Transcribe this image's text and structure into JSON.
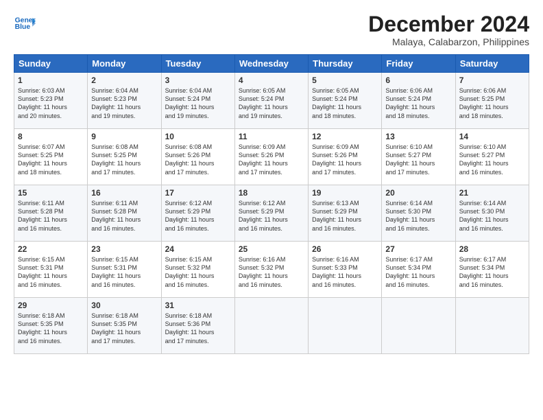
{
  "logo": {
    "line1": "General",
    "line2": "Blue"
  },
  "title": "December 2024",
  "location": "Malaya, Calabarzon, Philippines",
  "days_of_week": [
    "Sunday",
    "Monday",
    "Tuesday",
    "Wednesday",
    "Thursday",
    "Friday",
    "Saturday"
  ],
  "weeks": [
    [
      {
        "day": 1,
        "detail": "Sunrise: 6:03 AM\nSunset: 5:23 PM\nDaylight: 11 hours\nand 20 minutes."
      },
      {
        "day": 2,
        "detail": "Sunrise: 6:04 AM\nSunset: 5:23 PM\nDaylight: 11 hours\nand 19 minutes."
      },
      {
        "day": 3,
        "detail": "Sunrise: 6:04 AM\nSunset: 5:24 PM\nDaylight: 11 hours\nand 19 minutes."
      },
      {
        "day": 4,
        "detail": "Sunrise: 6:05 AM\nSunset: 5:24 PM\nDaylight: 11 hours\nand 19 minutes."
      },
      {
        "day": 5,
        "detail": "Sunrise: 6:05 AM\nSunset: 5:24 PM\nDaylight: 11 hours\nand 18 minutes."
      },
      {
        "day": 6,
        "detail": "Sunrise: 6:06 AM\nSunset: 5:24 PM\nDaylight: 11 hours\nand 18 minutes."
      },
      {
        "day": 7,
        "detail": "Sunrise: 6:06 AM\nSunset: 5:25 PM\nDaylight: 11 hours\nand 18 minutes."
      }
    ],
    [
      {
        "day": 8,
        "detail": "Sunrise: 6:07 AM\nSunset: 5:25 PM\nDaylight: 11 hours\nand 18 minutes."
      },
      {
        "day": 9,
        "detail": "Sunrise: 6:08 AM\nSunset: 5:25 PM\nDaylight: 11 hours\nand 17 minutes."
      },
      {
        "day": 10,
        "detail": "Sunrise: 6:08 AM\nSunset: 5:26 PM\nDaylight: 11 hours\nand 17 minutes."
      },
      {
        "day": 11,
        "detail": "Sunrise: 6:09 AM\nSunset: 5:26 PM\nDaylight: 11 hours\nand 17 minutes."
      },
      {
        "day": 12,
        "detail": "Sunrise: 6:09 AM\nSunset: 5:26 PM\nDaylight: 11 hours\nand 17 minutes."
      },
      {
        "day": 13,
        "detail": "Sunrise: 6:10 AM\nSunset: 5:27 PM\nDaylight: 11 hours\nand 17 minutes."
      },
      {
        "day": 14,
        "detail": "Sunrise: 6:10 AM\nSunset: 5:27 PM\nDaylight: 11 hours\nand 16 minutes."
      }
    ],
    [
      {
        "day": 15,
        "detail": "Sunrise: 6:11 AM\nSunset: 5:28 PM\nDaylight: 11 hours\nand 16 minutes."
      },
      {
        "day": 16,
        "detail": "Sunrise: 6:11 AM\nSunset: 5:28 PM\nDaylight: 11 hours\nand 16 minutes."
      },
      {
        "day": 17,
        "detail": "Sunrise: 6:12 AM\nSunset: 5:29 PM\nDaylight: 11 hours\nand 16 minutes."
      },
      {
        "day": 18,
        "detail": "Sunrise: 6:12 AM\nSunset: 5:29 PM\nDaylight: 11 hours\nand 16 minutes."
      },
      {
        "day": 19,
        "detail": "Sunrise: 6:13 AM\nSunset: 5:29 PM\nDaylight: 11 hours\nand 16 minutes."
      },
      {
        "day": 20,
        "detail": "Sunrise: 6:14 AM\nSunset: 5:30 PM\nDaylight: 11 hours\nand 16 minutes."
      },
      {
        "day": 21,
        "detail": "Sunrise: 6:14 AM\nSunset: 5:30 PM\nDaylight: 11 hours\nand 16 minutes."
      }
    ],
    [
      {
        "day": 22,
        "detail": "Sunrise: 6:15 AM\nSunset: 5:31 PM\nDaylight: 11 hours\nand 16 minutes."
      },
      {
        "day": 23,
        "detail": "Sunrise: 6:15 AM\nSunset: 5:31 PM\nDaylight: 11 hours\nand 16 minutes."
      },
      {
        "day": 24,
        "detail": "Sunrise: 6:15 AM\nSunset: 5:32 PM\nDaylight: 11 hours\nand 16 minutes."
      },
      {
        "day": 25,
        "detail": "Sunrise: 6:16 AM\nSunset: 5:32 PM\nDaylight: 11 hours\nand 16 minutes."
      },
      {
        "day": 26,
        "detail": "Sunrise: 6:16 AM\nSunset: 5:33 PM\nDaylight: 11 hours\nand 16 minutes."
      },
      {
        "day": 27,
        "detail": "Sunrise: 6:17 AM\nSunset: 5:34 PM\nDaylight: 11 hours\nand 16 minutes."
      },
      {
        "day": 28,
        "detail": "Sunrise: 6:17 AM\nSunset: 5:34 PM\nDaylight: 11 hours\nand 16 minutes."
      }
    ],
    [
      {
        "day": 29,
        "detail": "Sunrise: 6:18 AM\nSunset: 5:35 PM\nDaylight: 11 hours\nand 16 minutes."
      },
      {
        "day": 30,
        "detail": "Sunrise: 6:18 AM\nSunset: 5:35 PM\nDaylight: 11 hours\nand 17 minutes."
      },
      {
        "day": 31,
        "detail": "Sunrise: 6:18 AM\nSunset: 5:36 PM\nDaylight: 11 hours\nand 17 minutes."
      },
      null,
      null,
      null,
      null
    ]
  ]
}
